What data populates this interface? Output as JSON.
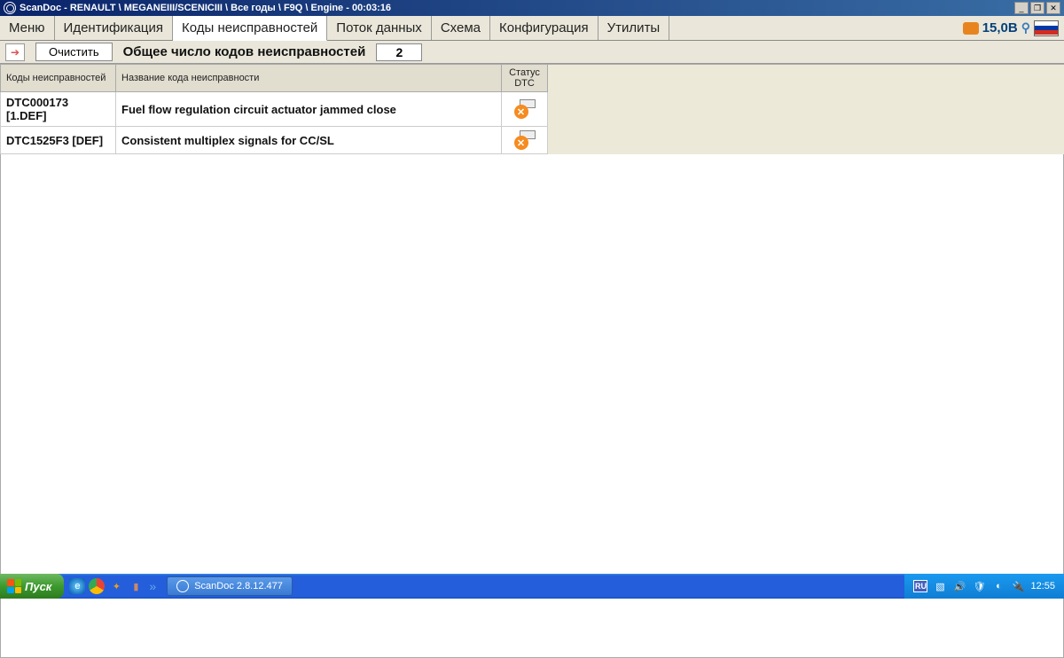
{
  "titlebar": {
    "text": "ScanDoc - RENAULT \\ MEGANEIII/SCENICIII \\ Все годы \\ F9Q \\ Engine - 00:03:16"
  },
  "tabs": {
    "items": [
      {
        "label": "Меню"
      },
      {
        "label": "Идентификация"
      },
      {
        "label": "Коды неисправностей"
      },
      {
        "label": "Поток данных"
      },
      {
        "label": "Схема"
      },
      {
        "label": "Конфигурация"
      },
      {
        "label": "Утилиты"
      }
    ],
    "voltage": "15,0В"
  },
  "toolbar": {
    "clear_label": "Очистить",
    "total_label": "Общее число кодов неисправностей",
    "count": "2"
  },
  "table": {
    "headers": {
      "code": "Коды неисправностей",
      "name": "Название кода неисправности",
      "status": "Статус DTC"
    },
    "rows": [
      {
        "code": "DTC000173 [1.DEF]",
        "name": "Fuel flow regulation circuit actuator jammed close"
      },
      {
        "code": "DTC1525F3 [DEF]",
        "name": "Consistent multiplex signals for CC/SL"
      }
    ]
  },
  "taskbar": {
    "start": "Пуск",
    "app": "ScanDoc 2.8.12.477",
    "lang": "RU",
    "clock": "12:55"
  }
}
